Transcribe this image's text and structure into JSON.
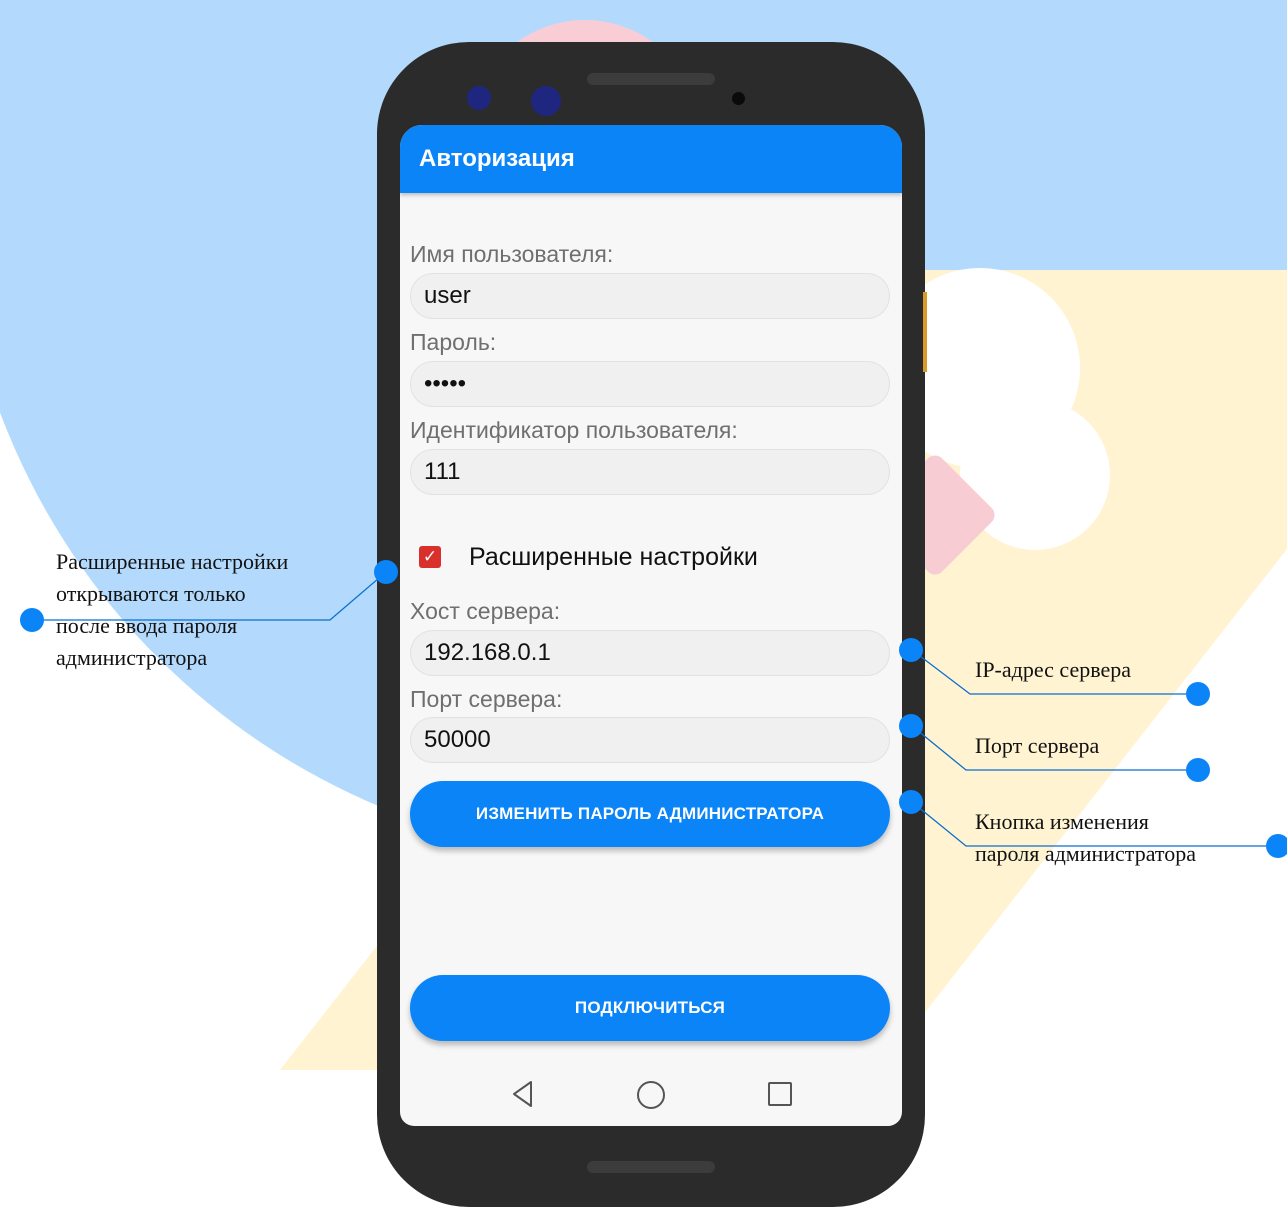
{
  "app_title": "Авторизация",
  "form": {
    "username_label": "Имя пользователя:",
    "username_value": "user",
    "password_label": "Пароль:",
    "password_value": "•••••",
    "user_id_label": "Идентификатор пользователя:",
    "user_id_value": "111",
    "advanced_label": "Расширенные настройки",
    "advanced_checked": true,
    "host_label": "Хост сервера:",
    "host_value": "192.168.0.1",
    "port_label": "Порт сервера:",
    "port_value": "50000",
    "change_admin_pw_button": "ИЗМЕНИТЬ ПАРОЛЬ АДМИНИСТРАТОРА",
    "connect_button": "ПОДКЛЮЧИТЬСЯ"
  },
  "navbar": {
    "icons": [
      "back-icon",
      "home-icon",
      "recent-apps-icon"
    ]
  },
  "callouts": {
    "advanced": [
      "Расширенные настройки",
      "открываются только",
      "после ввода пароля",
      "администратора"
    ],
    "ip": "IP-адрес сервера",
    "port": "Порт сервера",
    "change_pw": [
      "Кнопка изменения",
      "пароля администратора"
    ]
  },
  "colors": {
    "accent": "#0a84f7",
    "checkbox": "#d9302c",
    "background_circle": "#b3dafd"
  }
}
